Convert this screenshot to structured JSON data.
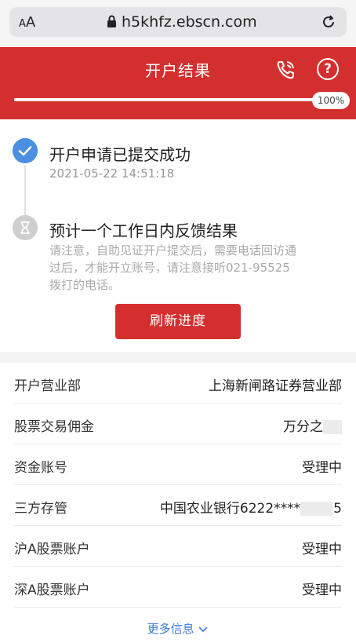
{
  "browser": {
    "aa_small": "A",
    "aa_large": "A",
    "url": "h5khfz.ebscn.com"
  },
  "header": {
    "title": "开户结果",
    "progress_label": "100%",
    "progress_value": 100
  },
  "steps": [
    {
      "title": "开户申请已提交成功",
      "time": "2021-05-22 14:51:18"
    },
    {
      "title": "预计一个工作日内反馈结果",
      "note": "请注意，自助见证开户提交后，需要电话回访通过后，才能开立账号，请注意接听021-95525拨打的电话。"
    }
  ],
  "refresh_button": "刷新进度",
  "info": [
    {
      "label": "开户营业部",
      "value": "上海新闸路证券营业部"
    },
    {
      "label": "股票交易佣金",
      "value": "万分之"
    },
    {
      "label": "资金账号",
      "value": "受理中"
    },
    {
      "label": "三方存管",
      "value": "中国农业银行6222****",
      "value_suffix": "5"
    },
    {
      "label": "沪A股票账户",
      "value": "受理中"
    },
    {
      "label": "深A股票账户",
      "value": "受理中"
    }
  ],
  "more_link": "更多信息",
  "colors": {
    "brand_red": "#d32f2f",
    "check_blue": "#4a8fe0",
    "link_blue": "#3e7bd6"
  }
}
